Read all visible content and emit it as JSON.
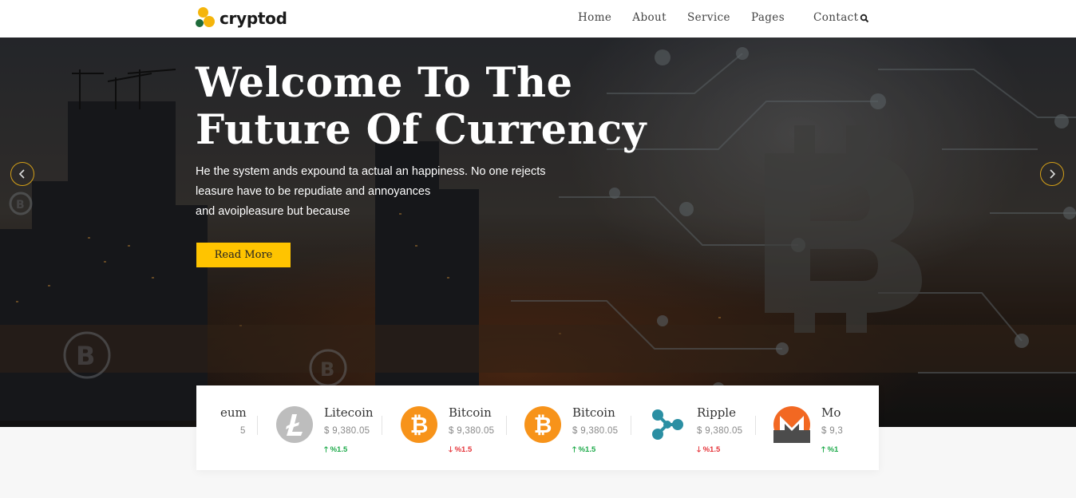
{
  "brand": {
    "name": "cryptod",
    "colors": {
      "accent": "#ffc400",
      "logo_yellow": "#f5b50b",
      "logo_green": "#1e6b3a"
    }
  },
  "nav": {
    "items": [
      "Home",
      "About",
      "Service",
      "Pages",
      "Contact"
    ],
    "search_icon": "search-icon"
  },
  "hero": {
    "title_line1": "Welcome To The",
    "title_line2": "Future Of Currency",
    "desc_line1": "He the system ands expound ta actual an happiness. No one rejects",
    "desc_line2": "leasure have to be repudiate and annoyances",
    "desc_line3": "and avoipleasure but because",
    "button": "Read More",
    "prev_icon": "chevron-left-icon",
    "next_icon": "chevron-right-icon"
  },
  "ticker": {
    "coins": [
      {
        "name": "eum",
        "price": "5",
        "change": "",
        "direction": "up",
        "icon": "ethereum-icon"
      },
      {
        "name": "Litecoin",
        "price": "$ 9,380.05",
        "change": "%1.5",
        "direction": "up",
        "icon": "litecoin-icon"
      },
      {
        "name": "Bitcoin",
        "price": "$ 9,380.05",
        "change": "%1.5",
        "direction": "down",
        "icon": "bitcoin-icon"
      },
      {
        "name": "Bitcoin",
        "price": "$ 9,380.05",
        "change": "%1.5",
        "direction": "up",
        "icon": "bitcoin-icon"
      },
      {
        "name": "Ripple",
        "price": "$ 9,380.05",
        "change": "%1.5",
        "direction": "down",
        "icon": "ripple-icon"
      },
      {
        "name": "Mo",
        "price": "$ 9,3",
        "change": "%1",
        "direction": "up",
        "icon": "monero-icon"
      }
    ]
  }
}
